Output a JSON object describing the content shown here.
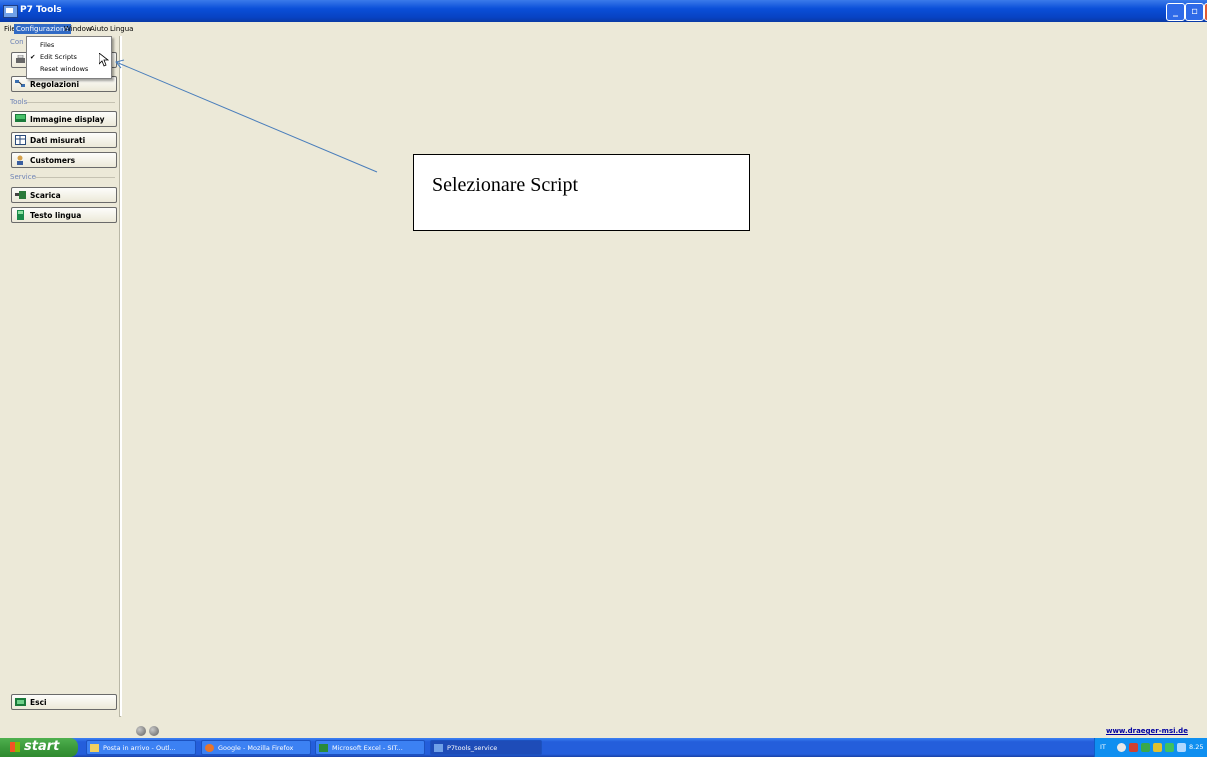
{
  "window": {
    "title": "P7 Tools"
  },
  "menubar": [
    {
      "label": "File"
    },
    {
      "label": "Configurazione"
    },
    {
      "label": "Window"
    },
    {
      "label": "Aiuto"
    },
    {
      "label": "Lingua"
    }
  ],
  "config_menu": [
    {
      "label": "Files",
      "checked": false
    },
    {
      "label": "Edit Scripts",
      "checked": true
    },
    {
      "label": "Reset windows",
      "checked": false
    }
  ],
  "sidebar": {
    "sections": [
      {
        "label": "Con"
      },
      {
        "label": "Tools"
      },
      {
        "label": "Service"
      }
    ],
    "config_buttons": [
      {
        "label": "",
        "icon": "printer-icon"
      },
      {
        "label": "Regolazioni",
        "icon": "settings-icon"
      }
    ],
    "tools_buttons": [
      {
        "label": "Immagine display",
        "icon": "display-icon"
      },
      {
        "label": "Dati misurati",
        "icon": "table-icon"
      },
      {
        "label": "Customers",
        "icon": "customers-icon"
      }
    ],
    "service_buttons": [
      {
        "label": "Scarica",
        "icon": "download-icon"
      },
      {
        "label": "Testo lingua",
        "icon": "language-icon"
      }
    ],
    "exit_button": {
      "label": "Esci",
      "icon": "exit-icon"
    }
  },
  "annotation": {
    "text": "Selezionare Script"
  },
  "status": {
    "website": "www.draeger-msi.de"
  },
  "taskbar": {
    "start_label": "start",
    "tasks": [
      {
        "label": "Posta in arrivo - Outl..."
      },
      {
        "label": "Google - Mozilla Firefox"
      },
      {
        "label": "Microsoft Excel - SIT..."
      },
      {
        "label": "P7tools_service"
      }
    ],
    "tray": {
      "language": "IT",
      "clock": "8.25"
    }
  },
  "colors": {
    "titlebar": "#0a4fd8",
    "menu_highlight": "#316ac5",
    "taskbar": "#245edb",
    "start": "#3c9a3c"
  }
}
